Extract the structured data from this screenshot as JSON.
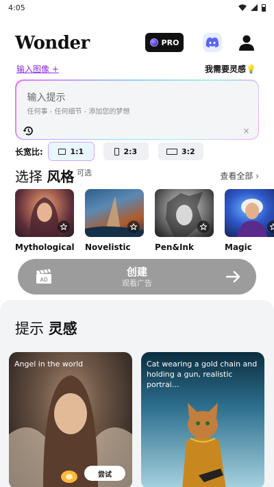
{
  "status_bar": {
    "time": "4:05"
  },
  "header": {
    "logo": "Wonder",
    "pro_label": "PRO"
  },
  "prompt": {
    "upload_label": "输入图像",
    "upload_plus": "+",
    "inspire_label": "我需要灵感💡",
    "title": "输入提示",
    "placeholder": "任何事 - 任何细节 - 添加您的梦想",
    "clear": "×"
  },
  "aspect": {
    "label": "长宽比:",
    "options": [
      {
        "label": "1:1",
        "active": true
      },
      {
        "label": "2:3",
        "active": false
      },
      {
        "label": "3:2",
        "active": false
      }
    ]
  },
  "styles": {
    "title_prefix": "选择",
    "title_bold": "风格",
    "optional": "可选",
    "see_all": "查看全部 ›",
    "items": [
      {
        "name": "Mythological"
      },
      {
        "name": "Novelistic"
      },
      {
        "name": "Pen&Ink"
      },
      {
        "name": "Magic"
      }
    ]
  },
  "create": {
    "label": "创建",
    "sub": "观看广告"
  },
  "inspiration": {
    "title_prefix": "提示",
    "title_bold": "灵感",
    "cards": [
      {
        "caption": "Angel in the world",
        "try": "尝试"
      },
      {
        "caption": "Cat wearing a gold chain and holding a gun, realistic portrai..."
      }
    ]
  }
}
